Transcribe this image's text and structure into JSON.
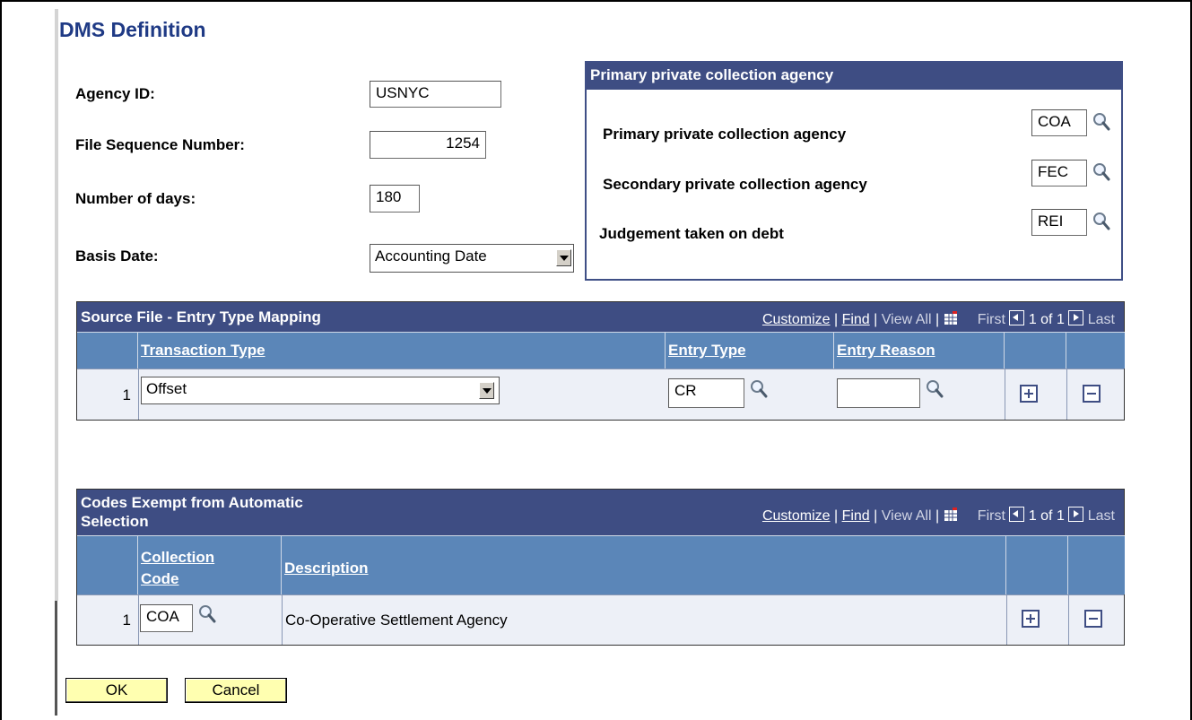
{
  "page": {
    "title": "DMS Definition"
  },
  "fields": {
    "agency_id": {
      "label": "Agency ID:",
      "value": "USNYC"
    },
    "file_seq": {
      "label": "File Sequence Number:",
      "value": "1254"
    },
    "num_days": {
      "label": "Number of days:",
      "value": "180"
    },
    "basis_date": {
      "label": "Basis Date:",
      "value": "Accounting Date"
    }
  },
  "agency_box": {
    "title": "Primary private collection agency",
    "rows": [
      {
        "label": "Primary private collection agency",
        "value": "COA"
      },
      {
        "label": "Secondary private collection agency",
        "value": "FEC"
      },
      {
        "label": "Judgement taken on debt",
        "value": "REI"
      }
    ]
  },
  "grid_nav": {
    "customize": "Customize",
    "sep": "|",
    "find": "Find",
    "view_all": "View All",
    "first": "First",
    "count": "1 of 1",
    "last": "Last"
  },
  "mapping_grid": {
    "title": "Source File - Entry Type Mapping",
    "columns": {
      "transaction_type": "Transaction Type",
      "entry_type": "Entry Type",
      "entry_reason": "Entry Reason"
    },
    "rows": [
      {
        "num": "1",
        "transaction_type": "Offset",
        "entry_type": "CR",
        "entry_reason": ""
      }
    ]
  },
  "exempt_grid": {
    "title_line1": "Codes Exempt from Automatic",
    "title_line2": "Selection",
    "columns": {
      "collection_code_1": "Collection",
      "collection_code_2": "Code",
      "description": "Description"
    },
    "rows": [
      {
        "num": "1",
        "code": "COA",
        "description": "Co-Operative Settlement Agency"
      }
    ]
  },
  "buttons": {
    "ok": "OK",
    "cancel": "Cancel"
  },
  "icons": {
    "lookup": "magnifier-icon",
    "add": "plus-icon",
    "delete": "minus-icon",
    "grid": "grid-download-icon"
  },
  "colors": {
    "header": "#3e4d83",
    "column_header": "#5b86b8",
    "title": "#1f3a85",
    "button": "#ffffb0"
  }
}
